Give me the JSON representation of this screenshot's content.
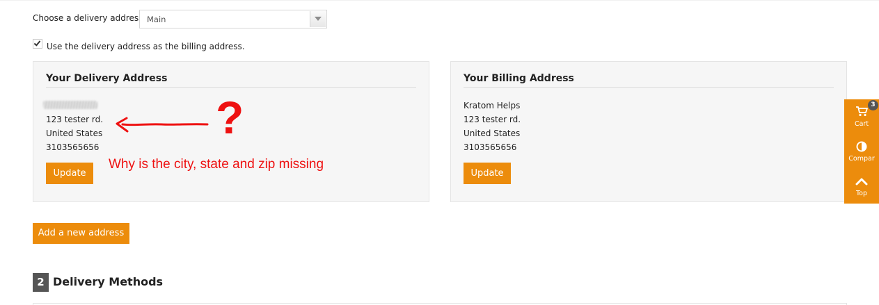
{
  "delivery_select": {
    "label": "Choose a delivery address:",
    "value": "Main"
  },
  "billing_checkbox": {
    "label": "Use the delivery address as the billing address.",
    "checked": true
  },
  "delivery_address": {
    "title": "Your Delivery Address",
    "lines": [
      "123 tester rd.",
      "United States",
      "3103565656"
    ],
    "update_label": "Update"
  },
  "billing_address": {
    "title": "Your Billing Address",
    "lines": [
      "Kratom Helps",
      "123 tester rd.",
      "United States",
      "3103565656"
    ],
    "update_label": "Update"
  },
  "add_address_label": "Add a new address",
  "step": {
    "number": "2",
    "title": "Delivery Methods"
  },
  "annotation": {
    "question_mark": "?",
    "text": "Why is the city, state and zip missing",
    "color": "#ee1111"
  },
  "side_toolbar": {
    "cart_label": "Cart",
    "cart_count": "3",
    "compare_label": "Compar",
    "top_label": "Top",
    "color": "#ec8c0c"
  },
  "colors": {
    "accent": "#ec8c0c",
    "panel_bg": "#f6f6f6"
  }
}
